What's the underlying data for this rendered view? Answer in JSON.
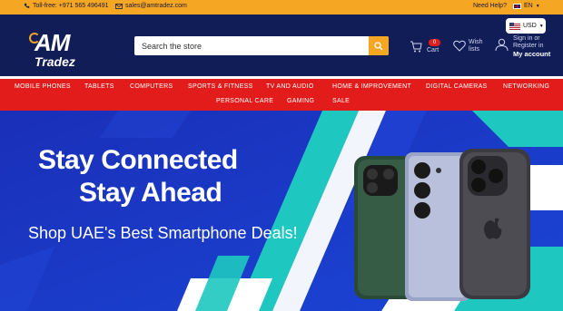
{
  "topbar": {
    "phone_label": "Toll-free: +971 565 496491",
    "email_label": "sales@amtradez.com",
    "help_label": "Need Help?",
    "language_label": "EN"
  },
  "header": {
    "logo_top": "AM",
    "logo_bottom": "Tradez",
    "currency_label": "USD",
    "search_placeholder": "Search the store",
    "cart_count": "0",
    "cart_label": "Cart",
    "wishlist_label": "Wish lists",
    "account_line1": "Sign in or Register in",
    "account_line2": "My account"
  },
  "nav": {
    "items": [
      "MOBILE PHONES",
      "TABLETS",
      "COMPUTERS",
      "SPORTS & FITNESS",
      "TV AND AUDIO",
      "HOME & IMPROVEMENT",
      "DIGITAL CAMERAS",
      "NETWORKING",
      "PERSONAL CARE",
      "GAMING",
      "SALE"
    ]
  },
  "hero": {
    "headline_line1": "Stay Connected",
    "headline_line2": "Stay Ahead",
    "subheadline": "Shop UAE's Best Smartphone Deals!"
  },
  "colors": {
    "accent": "#f5a623",
    "header_bg": "#111d57",
    "nav_bg": "#e21b1b",
    "hero_bg": "#1a37c8",
    "hero_deco_teal": "#1ec8c0"
  }
}
